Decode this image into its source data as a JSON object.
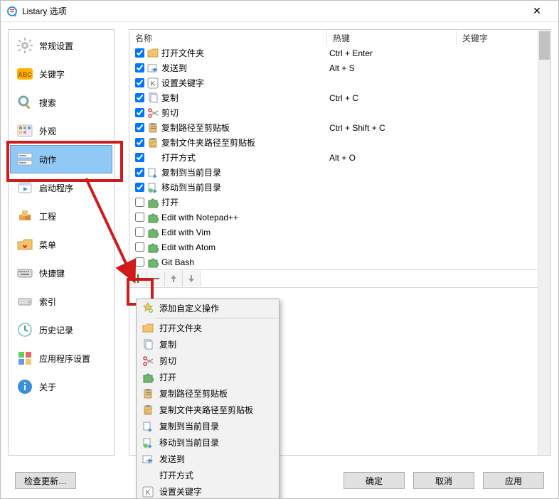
{
  "window": {
    "title": "Listary 选项"
  },
  "sidebar": {
    "items": [
      {
        "label": "常规设置",
        "icon": "gear-icon"
      },
      {
        "label": "关键字",
        "icon": "abc-icon"
      },
      {
        "label": "搜索",
        "icon": "magnifier-icon"
      },
      {
        "label": "外观",
        "icon": "palette-icon"
      },
      {
        "label": "动作",
        "icon": "actions-icon",
        "selected": true
      },
      {
        "label": "启动程序",
        "icon": "launcher-icon"
      },
      {
        "label": "工程",
        "icon": "boxes-icon"
      },
      {
        "label": "菜单",
        "icon": "folder-heart-icon"
      },
      {
        "label": "快捷键",
        "icon": "keyboard-icon"
      },
      {
        "label": "索引",
        "icon": "drive-icon"
      },
      {
        "label": "历史记录",
        "icon": "clock-icon"
      },
      {
        "label": "应用程序设置",
        "icon": "apps-icon"
      },
      {
        "label": "关于",
        "icon": "info-icon"
      }
    ]
  },
  "columns": {
    "name": "名称",
    "hotkey": "热键",
    "keyword": "关键字"
  },
  "rows": [
    {
      "checked": true,
      "icon": "folder-icon",
      "name": "打开文件夹",
      "hotkey": "Ctrl + Enter"
    },
    {
      "checked": true,
      "icon": "send-icon",
      "name": "发送到",
      "hotkey": "Alt + S"
    },
    {
      "checked": true,
      "icon": "k-icon",
      "name": "设置关键字",
      "hotkey": ""
    },
    {
      "checked": true,
      "icon": "copy-icon",
      "name": "复制",
      "hotkey": "Ctrl + C"
    },
    {
      "checked": true,
      "icon": "scissors-icon",
      "name": "剪切",
      "hotkey": ""
    },
    {
      "checked": true,
      "icon": "clipboard-path-icon",
      "name": "复制路径至剪贴板",
      "hotkey": "Ctrl + Shift + C"
    },
    {
      "checked": true,
      "icon": "clipboard-folder-icon",
      "name": "复制文件夹路径至剪贴板",
      "hotkey": ""
    },
    {
      "checked": true,
      "icon": "blank-icon",
      "name": "打开方式",
      "hotkey": "Alt + O"
    },
    {
      "checked": true,
      "icon": "copy-to-icon",
      "name": "复制到当前目录",
      "hotkey": ""
    },
    {
      "checked": true,
      "icon": "move-to-icon",
      "name": "移动到当前目录",
      "hotkey": ""
    },
    {
      "checked": false,
      "icon": "puzzle-icon",
      "name": "打开",
      "hotkey": ""
    },
    {
      "checked": false,
      "icon": "puzzle-icon",
      "name": "Edit with Notepad++",
      "hotkey": ""
    },
    {
      "checked": false,
      "icon": "puzzle-icon",
      "name": "Edit with Vim",
      "hotkey": ""
    },
    {
      "checked": false,
      "icon": "puzzle-icon",
      "name": "Edit with Atom",
      "hotkey": ""
    },
    {
      "checked": false,
      "icon": "puzzle-icon",
      "name": "Git Bash",
      "hotkey": ""
    }
  ],
  "toolbar": {
    "add": "+",
    "remove": "−",
    "up": "↑",
    "down": "↓"
  },
  "popup": {
    "heading": "添加自定义操作",
    "items": [
      {
        "label": "打开文件夹",
        "icon": "folder-icon"
      },
      {
        "label": "复制",
        "icon": "copy-icon"
      },
      {
        "label": "剪切",
        "icon": "scissors-icon"
      },
      {
        "label": "打开",
        "icon": "puzzle-icon"
      },
      {
        "label": "复制路径至剪贴板",
        "icon": "clipboard-path-icon"
      },
      {
        "label": "复制文件夹路径至剪贴板",
        "icon": "clipboard-folder-icon"
      },
      {
        "label": "复制到当前目录",
        "icon": "copy-to-icon"
      },
      {
        "label": "移动到当前目录",
        "icon": "move-to-icon"
      },
      {
        "label": "发送到",
        "icon": "send-icon"
      },
      {
        "label": "打开方式",
        "icon": "blank-icon"
      },
      {
        "label": "设置关键字",
        "icon": "k-icon"
      }
    ]
  },
  "footer": {
    "check_update": "检查更新…",
    "ok": "确定",
    "cancel": "取消",
    "apply": "应用"
  }
}
